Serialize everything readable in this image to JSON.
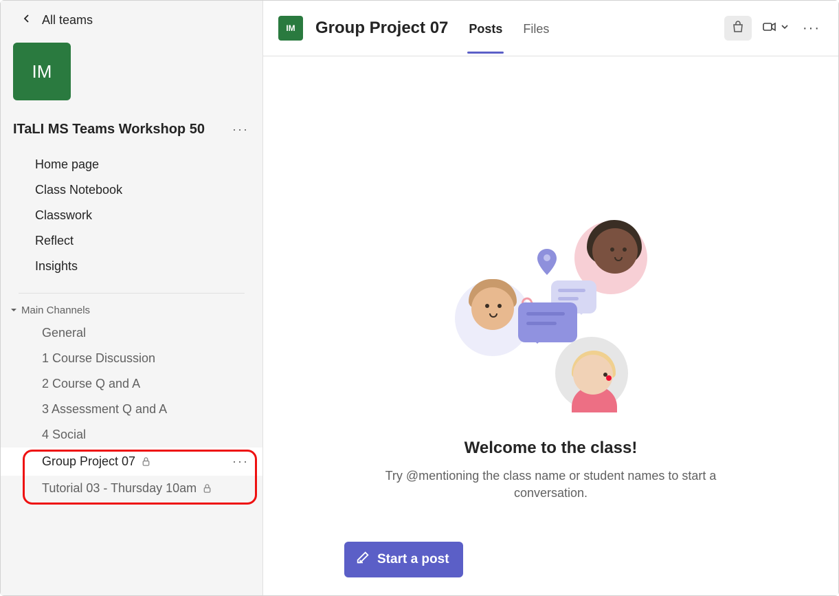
{
  "sidebar": {
    "back_label": "All teams",
    "team_initials": "IM",
    "team_name": "ITaLI MS Teams Workshop 50",
    "nav": [
      {
        "label": "Home page"
      },
      {
        "label": "Class Notebook"
      },
      {
        "label": "Classwork"
      },
      {
        "label": "Reflect"
      },
      {
        "label": "Insights"
      }
    ],
    "section_label": "Main Channels",
    "channels": [
      {
        "label": "General",
        "private": false,
        "active": false
      },
      {
        "label": "1 Course Discussion",
        "private": false,
        "active": false
      },
      {
        "label": "2 Course Q and A",
        "private": false,
        "active": false
      },
      {
        "label": "3 Assessment Q and A",
        "private": false,
        "active": false
      },
      {
        "label": "4 Social",
        "private": false,
        "active": false
      },
      {
        "label": "Group Project 07",
        "private": true,
        "active": true,
        "show_more": true
      },
      {
        "label": "Tutorial 03 - Thursday 10am",
        "private": true,
        "active": false
      }
    ]
  },
  "header": {
    "tile_initials": "IM",
    "channel_name": "Group Project 07",
    "tabs": [
      {
        "label": "Posts",
        "active": true
      },
      {
        "label": "Files",
        "active": false
      }
    ]
  },
  "content": {
    "welcome_title": "Welcome to the class!",
    "welcome_sub": "Try @mentioning the class name or student names to start a conversation.",
    "start_button": "Start a post"
  },
  "colors": {
    "brand_green": "#2a7a3f",
    "accent_purple": "#5b5fc7",
    "highlight_red": "#e11"
  }
}
